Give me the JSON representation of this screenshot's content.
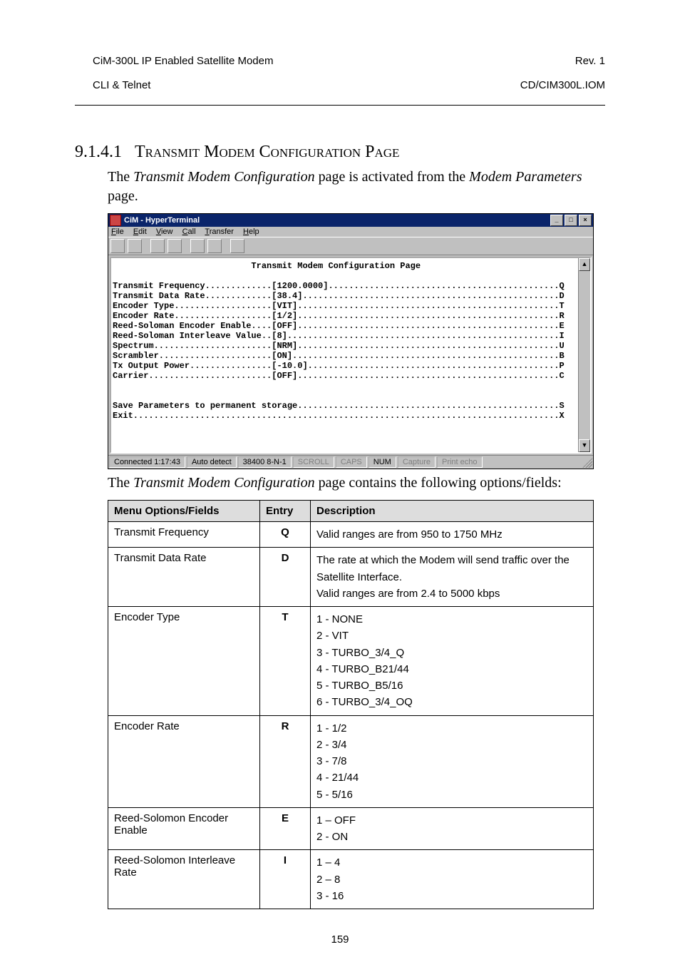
{
  "header": {
    "left_line1": "CiM-300L IP Enabled Satellite Modem",
    "left_line2": "CLI & Telnet",
    "right_line1": "Rev. 1",
    "right_line2": "CD/CIM300L.IOM"
  },
  "section": {
    "number": "9.1.4.1",
    "title": "Transmit Modem Configuration Page"
  },
  "intro": {
    "pre": "The ",
    "ital1": "Transmit Modem Configuration",
    "mid": " page is activated from the ",
    "ital2": "Modem Parameters",
    "post": " page."
  },
  "ht": {
    "title": "CiM - HyperTerminal",
    "menu": {
      "file": "File",
      "edit": "Edit",
      "view": "View",
      "call": "Call",
      "transfer": "Transfer",
      "help": "Help"
    },
    "content_title": "Transmit Modem Configuration Page",
    "lines": [
      {
        "label": "Transmit Frequency",
        "value": "[1200.0000]",
        "key": "Q"
      },
      {
        "label": "Transmit Data Rate",
        "value": "[38.4]",
        "key": "D"
      },
      {
        "label": "Encoder Type",
        "value": "[VIT]",
        "key": "T"
      },
      {
        "label": "Encoder Rate",
        "value": "[1/2]",
        "key": "R"
      },
      {
        "label": "Reed-Soloman Encoder Enable",
        "value": "[OFF]",
        "key": "E"
      },
      {
        "label": "Reed-Soloman Interleave Value",
        "value": "[8]",
        "key": "I"
      },
      {
        "label": "Spectrum",
        "value": "[NRM]",
        "key": "U"
      },
      {
        "label": "Scrambler",
        "value": "[ON]",
        "key": "B"
      },
      {
        "label": "Tx Output Power",
        "value": "[-10.0]",
        "key": "P"
      },
      {
        "label": "Carrier",
        "value": "[OFF]",
        "key": "C"
      }
    ],
    "footer_lines": [
      {
        "label": "Save Parameters to permanent storage",
        "key": "S"
      },
      {
        "label": "Exit",
        "key": "X"
      }
    ],
    "status": {
      "connected": "Connected 1:17:43",
      "auto": "Auto detect",
      "baud": "38400 8-N-1",
      "scroll": "SCROLL",
      "caps": "CAPS",
      "num": "NUM",
      "capture": "Capture",
      "print": "Print echo"
    }
  },
  "after_img": {
    "pre": "The ",
    "ital": "Transmit Modem Configuration",
    "post": " page contains the following options/fields:"
  },
  "table": {
    "headers": {
      "menu": "Menu Options/Fields",
      "entry": "Entry",
      "desc": "Description"
    },
    "rows": [
      {
        "menu": "Transmit Frequency",
        "entry": "Q",
        "desc": [
          "Valid ranges are from 950 to 1750 MHz"
        ]
      },
      {
        "menu": "Transmit Data Rate",
        "entry": "D",
        "desc": [
          "The rate at which the Modem will send traffic over the Satellite Interface.",
          "Valid ranges are from 2.4 to 5000 kbps"
        ]
      },
      {
        "menu": "Encoder Type",
        "entry": "T",
        "desc": [
          "1 - NONE",
          "2 - VIT",
          "3 - TURBO_3/4_Q",
          "4 - TURBO_B21/44",
          "5 - TURBO_B5/16",
          "6 - TURBO_3/4_OQ"
        ]
      },
      {
        "menu": "Encoder Rate",
        "entry": "R",
        "desc": [
          "1 - 1/2",
          "2 - 3/4",
          "3 - 7/8",
          "4 - 21/44",
          "5 - 5/16"
        ]
      },
      {
        "menu": "Reed-Solomon Encoder Enable",
        "entry": "E",
        "desc": [
          "1 – OFF",
          "2 - ON"
        ]
      },
      {
        "menu": "Reed-Solomon Interleave Rate",
        "entry": "I",
        "desc": [
          "1 – 4",
          "2 – 8",
          "3 - 16"
        ]
      }
    ]
  },
  "page_number": "159"
}
